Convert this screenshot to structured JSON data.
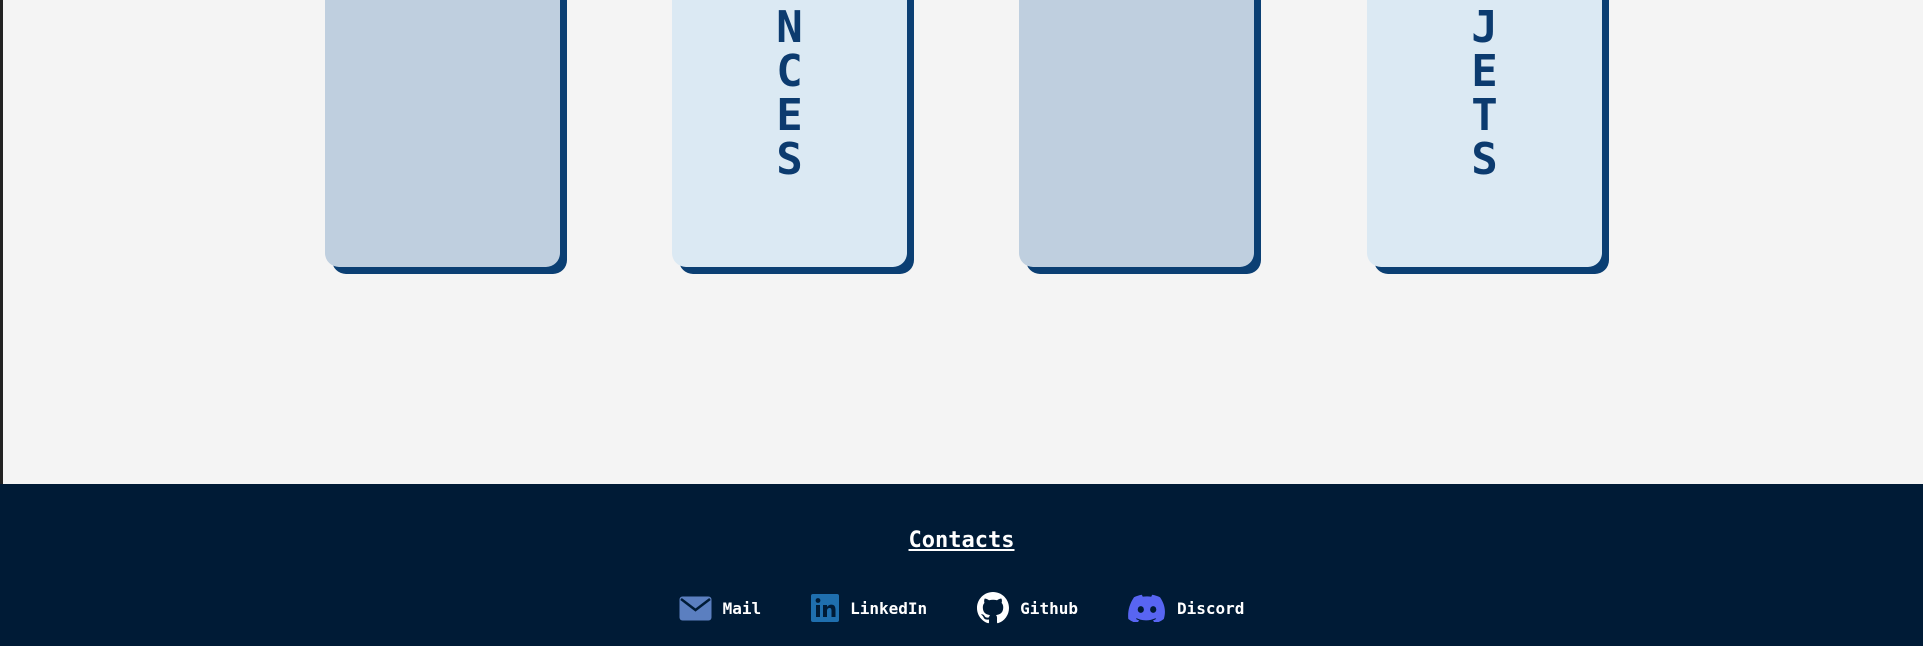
{
  "cards": [
    {
      "name": "card-1",
      "letters": [],
      "tone": "dark"
    },
    {
      "name": "card-experiences",
      "letters": [
        "N",
        "C",
        "E",
        "S"
      ],
      "tone": "light"
    },
    {
      "name": "card-3",
      "letters": [],
      "tone": "dark"
    },
    {
      "name": "card-projects",
      "letters": [
        "J",
        "E",
        "T",
        "S"
      ],
      "tone": "light"
    }
  ],
  "footer": {
    "title": "Contacts",
    "links": [
      {
        "label": "Mail",
        "icon": "mail-icon",
        "color": "#5b7fc0"
      },
      {
        "label": "LinkedIn",
        "icon": "linkedin-icon",
        "color": "#1f6fae"
      },
      {
        "label": "Github",
        "icon": "github-icon",
        "color": "#ffffff"
      },
      {
        "label": "Discord",
        "icon": "discord-icon",
        "color": "#5865f2"
      }
    ]
  },
  "colors": {
    "page_bg": "#f4f4f4",
    "card_dark": "#bfcfdf",
    "card_light": "#dbe9f3",
    "card_shadow": "#0b3f73",
    "card_text": "#0c3b6f",
    "footer_bg": "#001b36"
  }
}
